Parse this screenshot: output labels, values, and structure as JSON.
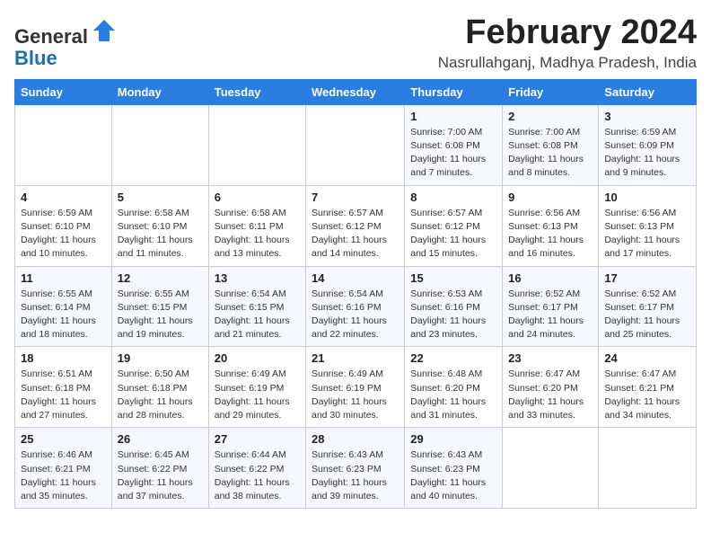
{
  "header": {
    "logo_general": "General",
    "logo_blue": "Blue",
    "month_title": "February 2024",
    "location": "Nasrullahganj, Madhya Pradesh, India"
  },
  "weekdays": [
    "Sunday",
    "Monday",
    "Tuesday",
    "Wednesday",
    "Thursday",
    "Friday",
    "Saturday"
  ],
  "weeks": [
    [
      {
        "day": "",
        "info": ""
      },
      {
        "day": "",
        "info": ""
      },
      {
        "day": "",
        "info": ""
      },
      {
        "day": "",
        "info": ""
      },
      {
        "day": "1",
        "info": "Sunrise: 7:00 AM\nSunset: 6:08 PM\nDaylight: 11 hours\nand 7 minutes."
      },
      {
        "day": "2",
        "info": "Sunrise: 7:00 AM\nSunset: 6:08 PM\nDaylight: 11 hours\nand 8 minutes."
      },
      {
        "day": "3",
        "info": "Sunrise: 6:59 AM\nSunset: 6:09 PM\nDaylight: 11 hours\nand 9 minutes."
      }
    ],
    [
      {
        "day": "4",
        "info": "Sunrise: 6:59 AM\nSunset: 6:10 PM\nDaylight: 11 hours\nand 10 minutes."
      },
      {
        "day": "5",
        "info": "Sunrise: 6:58 AM\nSunset: 6:10 PM\nDaylight: 11 hours\nand 11 minutes."
      },
      {
        "day": "6",
        "info": "Sunrise: 6:58 AM\nSunset: 6:11 PM\nDaylight: 11 hours\nand 13 minutes."
      },
      {
        "day": "7",
        "info": "Sunrise: 6:57 AM\nSunset: 6:12 PM\nDaylight: 11 hours\nand 14 minutes."
      },
      {
        "day": "8",
        "info": "Sunrise: 6:57 AM\nSunset: 6:12 PM\nDaylight: 11 hours\nand 15 minutes."
      },
      {
        "day": "9",
        "info": "Sunrise: 6:56 AM\nSunset: 6:13 PM\nDaylight: 11 hours\nand 16 minutes."
      },
      {
        "day": "10",
        "info": "Sunrise: 6:56 AM\nSunset: 6:13 PM\nDaylight: 11 hours\nand 17 minutes."
      }
    ],
    [
      {
        "day": "11",
        "info": "Sunrise: 6:55 AM\nSunset: 6:14 PM\nDaylight: 11 hours\nand 18 minutes."
      },
      {
        "day": "12",
        "info": "Sunrise: 6:55 AM\nSunset: 6:15 PM\nDaylight: 11 hours\nand 19 minutes."
      },
      {
        "day": "13",
        "info": "Sunrise: 6:54 AM\nSunset: 6:15 PM\nDaylight: 11 hours\nand 21 minutes."
      },
      {
        "day": "14",
        "info": "Sunrise: 6:54 AM\nSunset: 6:16 PM\nDaylight: 11 hours\nand 22 minutes."
      },
      {
        "day": "15",
        "info": "Sunrise: 6:53 AM\nSunset: 6:16 PM\nDaylight: 11 hours\nand 23 minutes."
      },
      {
        "day": "16",
        "info": "Sunrise: 6:52 AM\nSunset: 6:17 PM\nDaylight: 11 hours\nand 24 minutes."
      },
      {
        "day": "17",
        "info": "Sunrise: 6:52 AM\nSunset: 6:17 PM\nDaylight: 11 hours\nand 25 minutes."
      }
    ],
    [
      {
        "day": "18",
        "info": "Sunrise: 6:51 AM\nSunset: 6:18 PM\nDaylight: 11 hours\nand 27 minutes."
      },
      {
        "day": "19",
        "info": "Sunrise: 6:50 AM\nSunset: 6:18 PM\nDaylight: 11 hours\nand 28 minutes."
      },
      {
        "day": "20",
        "info": "Sunrise: 6:49 AM\nSunset: 6:19 PM\nDaylight: 11 hours\nand 29 minutes."
      },
      {
        "day": "21",
        "info": "Sunrise: 6:49 AM\nSunset: 6:19 PM\nDaylight: 11 hours\nand 30 minutes."
      },
      {
        "day": "22",
        "info": "Sunrise: 6:48 AM\nSunset: 6:20 PM\nDaylight: 11 hours\nand 31 minutes."
      },
      {
        "day": "23",
        "info": "Sunrise: 6:47 AM\nSunset: 6:20 PM\nDaylight: 11 hours\nand 33 minutes."
      },
      {
        "day": "24",
        "info": "Sunrise: 6:47 AM\nSunset: 6:21 PM\nDaylight: 11 hours\nand 34 minutes."
      }
    ],
    [
      {
        "day": "25",
        "info": "Sunrise: 6:46 AM\nSunset: 6:21 PM\nDaylight: 11 hours\nand 35 minutes."
      },
      {
        "day": "26",
        "info": "Sunrise: 6:45 AM\nSunset: 6:22 PM\nDaylight: 11 hours\nand 37 minutes."
      },
      {
        "day": "27",
        "info": "Sunrise: 6:44 AM\nSunset: 6:22 PM\nDaylight: 11 hours\nand 38 minutes."
      },
      {
        "day": "28",
        "info": "Sunrise: 6:43 AM\nSunset: 6:23 PM\nDaylight: 11 hours\nand 39 minutes."
      },
      {
        "day": "29",
        "info": "Sunrise: 6:43 AM\nSunset: 6:23 PM\nDaylight: 11 hours\nand 40 minutes."
      },
      {
        "day": "",
        "info": ""
      },
      {
        "day": "",
        "info": ""
      }
    ]
  ]
}
